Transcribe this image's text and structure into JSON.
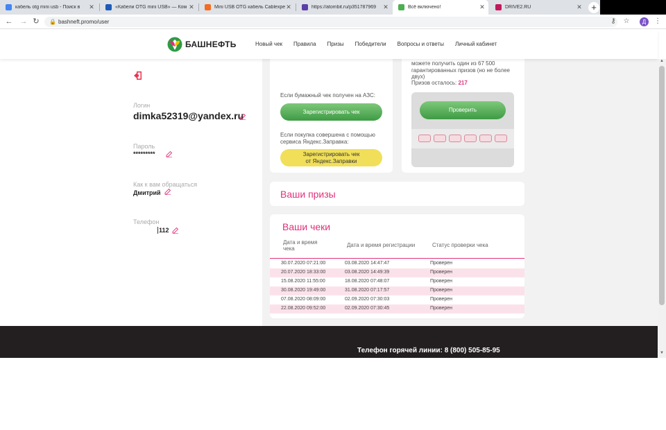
{
  "browser": {
    "tabs": [
      {
        "title": "кабель otg mini usb - Поиск в",
        "favicon_color": "#4285f4"
      },
      {
        "title": "«Кабели OTG mini USB» — Ком",
        "favicon_color": "#1e5bb8"
      },
      {
        "title": "Mini USB OTG кабель Cablexpe",
        "favicon_color": "#f36c21"
      },
      {
        "title": "https://atombit.ru/p351787969",
        "favicon_color": "#5b3fa8"
      },
      {
        "title": "Всё включено!",
        "favicon_color": "#4caf50",
        "active": true
      },
      {
        "title": "DRIVE2.RU",
        "favicon_color": "#c2185b"
      }
    ],
    "new_tab": "+",
    "url": "bashneft.promo/user",
    "avatar_letter": "Д"
  },
  "site": {
    "logo_text": "БАШНЕФТЬ",
    "menu": [
      "Новый чек",
      "Правила",
      "Призы",
      "Победители",
      "Вопросы и ответы",
      "Личный кабинет"
    ]
  },
  "profile": {
    "login_label": "Логин",
    "login_value": "dimka52319@yandex.ru",
    "password_label": "Пароль",
    "password_value": "*********",
    "name_label": "Как к вам обращаться",
    "name_value": "Дмитрий",
    "phone_label": "Телефон",
    "phone_value": "112"
  },
  "register_card": {
    "paper_text": "Если бумажный чек получен на АЗС:",
    "register_button": "Зарегистрировать чек",
    "yandex_text_1": "Если покупка совершена с помощью",
    "yandex_text_2": "сервиса Яндекс.Заправка:",
    "yandex_button_1": "Зарегистрировать чек",
    "yandex_button_2": "от Яндекс.Заправки"
  },
  "prize_card": {
    "text_1": "можете получить один из 67 500",
    "text_2": "гарантированных призов (но не более",
    "text_3": "двух)",
    "remaining_label": "Призов осталось:",
    "remaining_value": "217",
    "check_button": "Проверить",
    "code_cells": 6
  },
  "prizes_section": {
    "title": "Ваши призы"
  },
  "receipts": {
    "title": "Ваши чеки",
    "headers": [
      "Дата и время",
      "чека",
      "Дата и время регистрации",
      "Статус проверки чека"
    ],
    "rows": [
      {
        "date": "30.07.2020 07:21:00",
        "registered": "03.08.2020 14:47:47",
        "status": "Проверен"
      },
      {
        "date": "20.07.2020 18:33:00",
        "registered": "03.08.2020 14:49:39",
        "status": "Проверен"
      },
      {
        "date": "15.08.2020 11:55:00",
        "registered": "18.08.2020 07:48:07",
        "status": "Проверен"
      },
      {
        "date": "30.08.2020 19:49:00",
        "registered": "31.08.2020 07:17:57",
        "status": "Проверен"
      },
      {
        "date": "07.08.2020 08:09:00",
        "registered": "02.09.2020 07:30:03",
        "status": "Проверен"
      },
      {
        "date": "22.08.2020 09:52:00",
        "registered": "02.09.2020 07:30:45",
        "status": "Проверен"
      }
    ]
  },
  "footer": {
    "hotline": "Телефон горячей линии: 8 (800) 505-85-95"
  },
  "colors": {
    "accent_pink": "#e0317a",
    "green_button": "#4caf50",
    "yellow_button": "#f1df5a",
    "footer_bg": "#231f20"
  }
}
